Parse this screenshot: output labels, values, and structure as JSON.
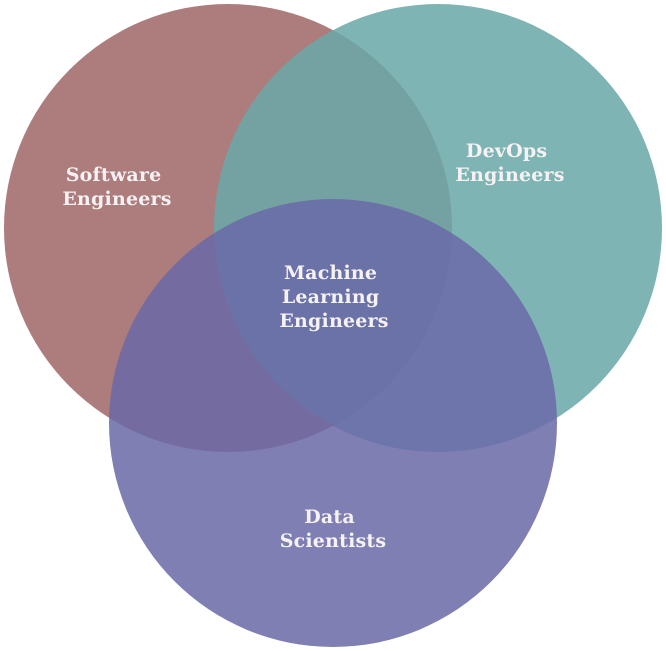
{
  "diagram": {
    "sets": {
      "software": {
        "line1": "Software",
        "line2": "Engineers",
        "color": "#a87070"
      },
      "devops": {
        "line1": "DevOps",
        "line2": "Engineers",
        "color": "#6fa8a8"
      },
      "data": {
        "line1": "Data",
        "line2": "Scientists",
        "color": "#6d6aa8"
      }
    },
    "intersection": {
      "line1": "Machine",
      "line2": "Learning",
      "line3": "Engineers"
    }
  }
}
